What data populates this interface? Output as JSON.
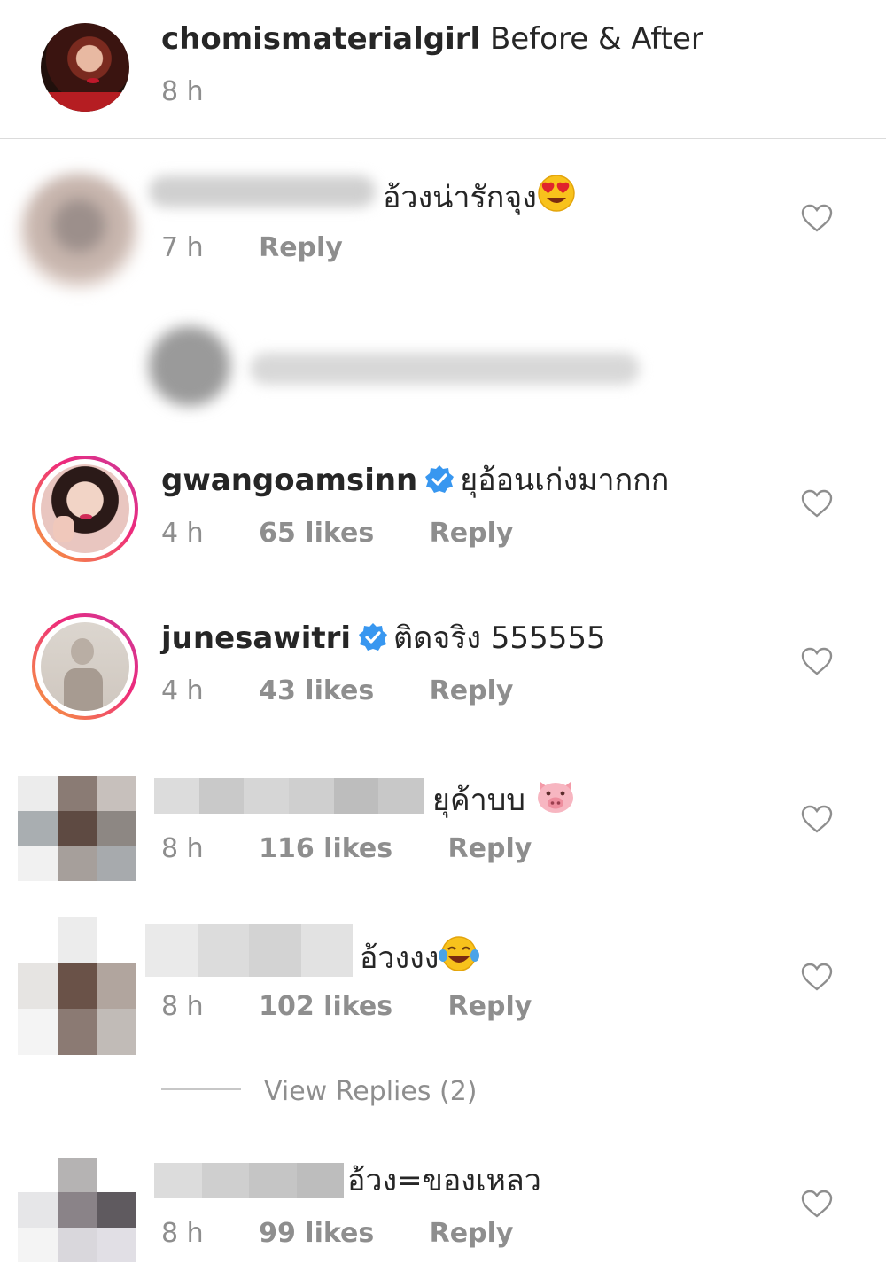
{
  "post": {
    "username": "chomismaterialgirl",
    "caption": "Before & After",
    "time": "8 h"
  },
  "comments": [
    {
      "text": "อ้วงน่ารักจุง",
      "time": "7 h",
      "reply": "Reply",
      "emoji": "heart-eyes"
    },
    {
      "username": "gwangoamsinn",
      "text": "ยุอ้อนเก่งมากกก",
      "time": "4 h",
      "likes": "65 likes",
      "reply": "Reply",
      "verified": true
    },
    {
      "username": "junesawitri",
      "text": "ติดจริง 555555",
      "time": "4 h",
      "likes": "43 likes",
      "reply": "Reply",
      "verified": true
    },
    {
      "text": "ยุค้าบบ",
      "time": "8 h",
      "likes": "116 likes",
      "reply": "Reply",
      "emoji": "pig"
    },
    {
      "text": "อ้วงงง",
      "time": "8 h",
      "likes": "102 likes",
      "reply": "Reply",
      "emoji": "tears-of-joy"
    },
    {
      "text": "อ้วง=ของเหลว",
      "time": "8 h",
      "likes": "99 likes",
      "reply": "Reply"
    }
  ],
  "view_replies": "View Replies (2)",
  "colors": {
    "verified": "#3897f0",
    "muted": "#8e8e8e",
    "text": "#262626"
  }
}
